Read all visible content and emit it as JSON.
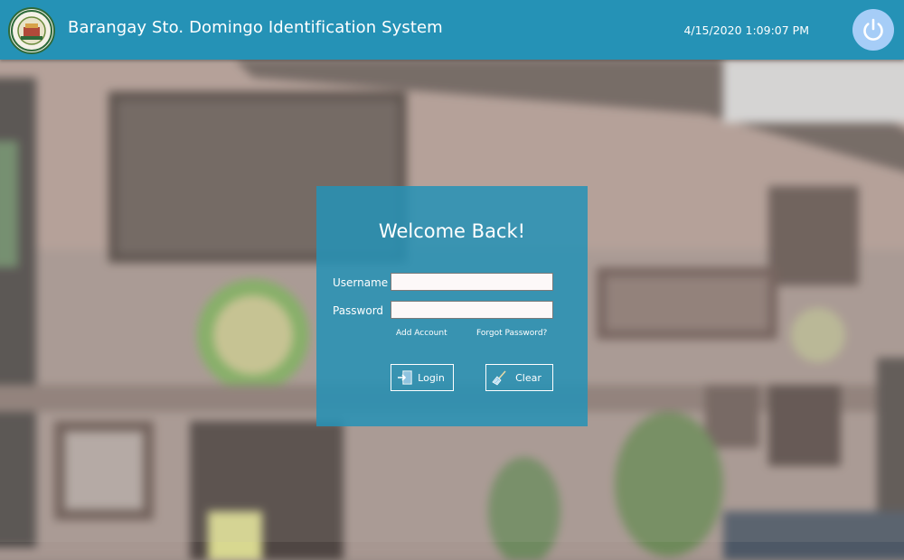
{
  "header": {
    "title": "Barangay Sto. Domingo Identification System",
    "datetime": "4/15/2020 1:09:07 PM",
    "logo_icon": "barangay-seal",
    "power_icon": "power-icon",
    "background_color": "#2592b6"
  },
  "login": {
    "heading": "Welcome Back!",
    "username_label": "Username",
    "username_value": "",
    "password_label": "Password",
    "password_value": "",
    "add_account": "Add Account",
    "forgot_password": "Forgot Password?",
    "login_button": "Login",
    "clear_button": "Clear",
    "panel_color": "#2592b6"
  }
}
